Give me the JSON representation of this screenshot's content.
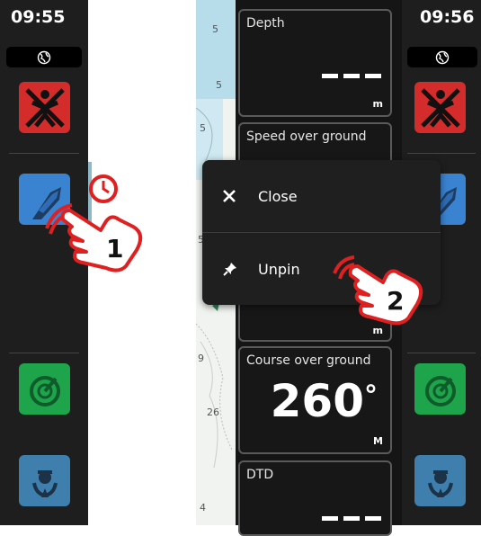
{
  "left_panel": {
    "time": "09:55",
    "globe_icon": "globe-icon",
    "apps": [
      "man-overboard-icon",
      "vessel-icon",
      "radar-icon",
      "autopilot-icon"
    ]
  },
  "right_panel": {
    "time": "09:56",
    "globe_icon": "globe-icon",
    "apps": [
      "man-overboard-icon",
      "vessel-icon",
      "radar-icon",
      "autopilot-icon"
    ]
  },
  "map": {
    "depth_labels": [
      "5",
      "5",
      "5",
      "5",
      "9",
      "26",
      "4"
    ]
  },
  "tiles": {
    "depth": {
      "label": "Depth",
      "unit": "m"
    },
    "sog": {
      "label": "Speed over ground",
      "unit": "m"
    },
    "cog": {
      "label": "Course over ground",
      "value": "260",
      "degree": "°",
      "unit": "M"
    },
    "dtd": {
      "label": "DTD"
    }
  },
  "popup": {
    "close_label": "Close",
    "unpin_label": "Unpin"
  },
  "steps": {
    "step1": "1",
    "step2": "2"
  },
  "colors": {
    "mob_red": "#d42b2b",
    "vessel_blue": "#3a83d1",
    "radar_green": "#1ea44b",
    "autopilot_steel": "#3e7fae",
    "hand_red": "#e02020"
  }
}
